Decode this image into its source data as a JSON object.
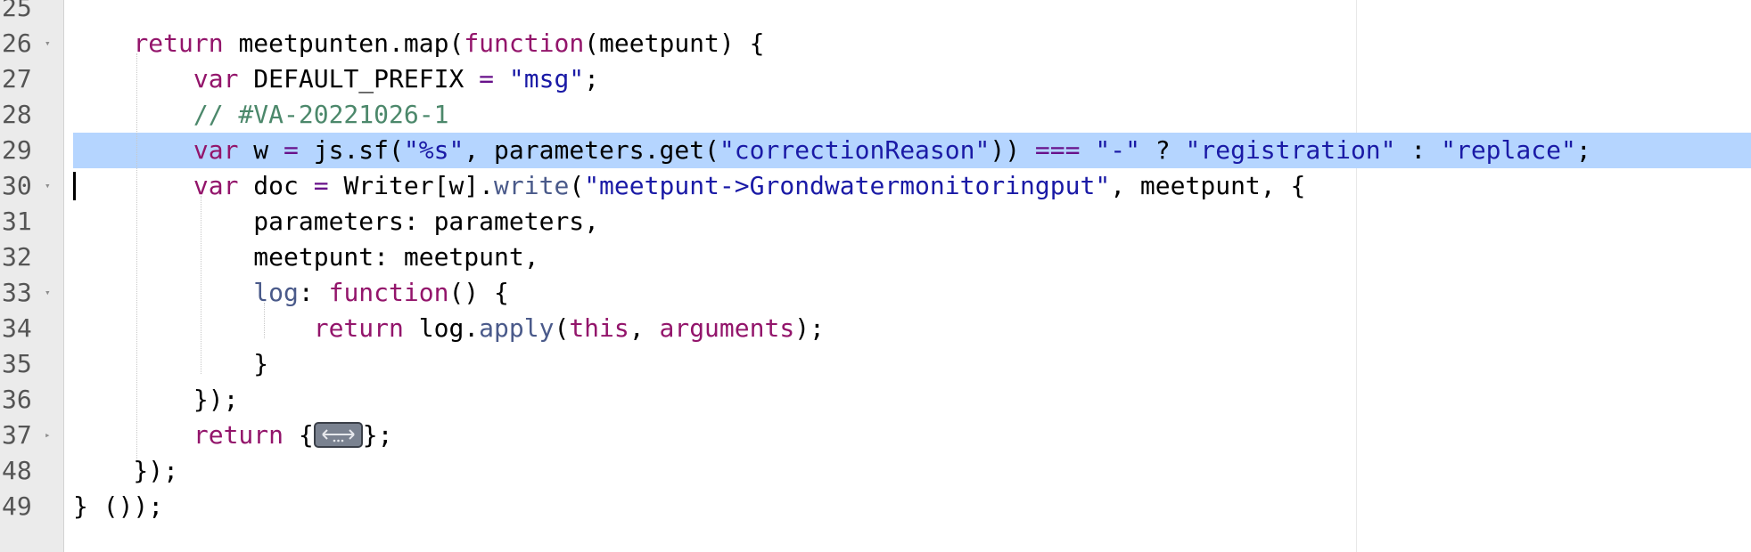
{
  "gutter": {
    "line_numbers": [
      "25",
      "26",
      "27",
      "28",
      "29",
      "30",
      "31",
      "32",
      "33",
      "34",
      "35",
      "36",
      "37",
      "48",
      "49"
    ],
    "fold_markers": [
      "",
      "▾",
      "",
      "",
      "",
      "▾",
      "",
      "",
      "▾",
      "",
      "",
      "",
      "▸",
      "",
      ""
    ]
  },
  "code": {
    "l26": {
      "a": "    ",
      "b": "return",
      "c": " meetpunten.map(",
      "d": "function",
      "e": "(meetpunt) {"
    },
    "l27": {
      "a": "        ",
      "b": "var",
      "c": " DEFAULT_PREFIX ",
      "d": "=",
      "e": " ",
      "f": "\"msg\"",
      "g": ";"
    },
    "l28": {
      "a": "        ",
      "b": "// #VA-20221026-1"
    },
    "l29": {
      "a": "        ",
      "b": "var",
      "c": " w ",
      "d": "=",
      "e": " js.sf(",
      "f": "\"%s\"",
      "g": ", parameters.get(",
      "h": "\"correctionReason\"",
      "i": ")) ",
      "j": "===",
      "k": " ",
      "l": "\"-\"",
      "m": " ? ",
      "n": "\"registration\"",
      "o": " : ",
      "p": "\"replace\"",
      "q": ";"
    },
    "l30": {
      "a": "        ",
      "b": "var",
      "c": " doc ",
      "d": "=",
      "e": " Writer[w].",
      "f": "write",
      "g": "(",
      "h": "\"meetpunt->Grondwatermonitoringput\"",
      "i": ", meetpunt, {"
    },
    "l31": {
      "a": "            parameters: parameters,"
    },
    "l32": {
      "a": "            meetpunt: meetpunt,"
    },
    "l33": {
      "a": "            ",
      "b": "log",
      "c": ": ",
      "d": "function",
      "e": "() {"
    },
    "l34": {
      "a": "                ",
      "b": "return",
      "c": " log.",
      "d": "apply",
      "e": "(",
      "f": "this",
      "g": ", ",
      "h": "arguments",
      "i": ");"
    },
    "l35": {
      "a": "            }"
    },
    "l36": {
      "a": "        });"
    },
    "l37": {
      "a": "        ",
      "b": "return",
      "c": " {",
      "e": "};"
    },
    "l48": {
      "a": "    });"
    },
    "l49": {
      "a": "} ());"
    }
  },
  "fold_widget_icon": "ellipsis-fold-icon",
  "colors": {
    "keyword": "#93156b",
    "string": "#1a1aa6",
    "comment": "#4c886b",
    "highlight": "#b5d5ff"
  }
}
